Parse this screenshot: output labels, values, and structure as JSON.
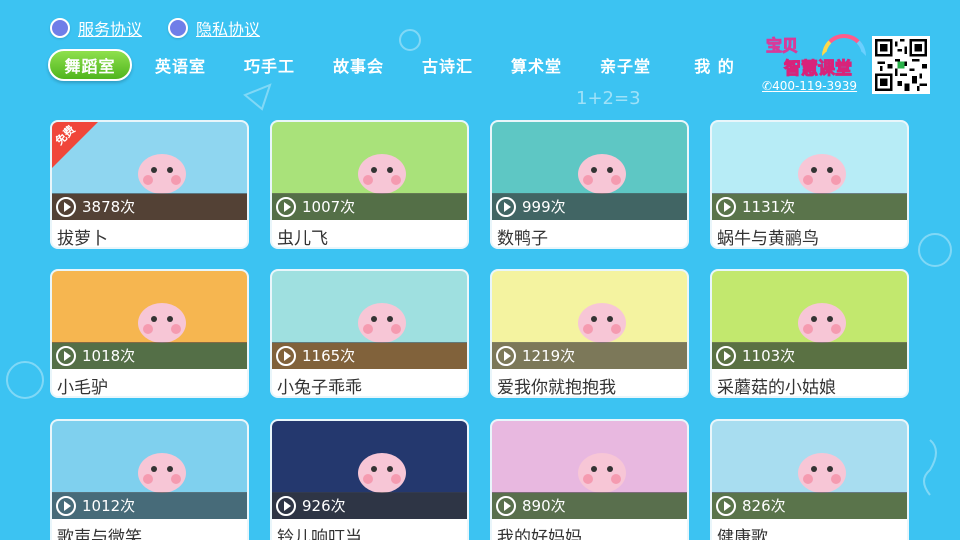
{
  "agreements": {
    "service": "服务协议",
    "privacy": "隐私协议"
  },
  "tabs": [
    "舞蹈室",
    "英语室",
    "巧手工",
    "故事会",
    "古诗汇",
    "算术堂",
    "亲子堂",
    "我 的"
  ],
  "active_tab": 0,
  "brand": {
    "logo_line1": "宝贝",
    "logo_line2": "智慧课堂",
    "phone": "400-119-3939"
  },
  "doodle_text": "1+2=3",
  "free_badge": "免费",
  "cards": [
    {
      "title": "拔萝卜",
      "plays": "3878次",
      "bg": "#8fd6f0",
      "ground": "#7a4a2a",
      "free": true
    },
    {
      "title": "虫儿飞",
      "plays": "1007次",
      "bg": "#a9e27a",
      "ground": "#7cc25a",
      "free": false
    },
    {
      "title": "数鸭子",
      "plays": "999次",
      "bg": "#5ec7c4",
      "ground": "#4aa8a6",
      "free": false
    },
    {
      "title": "蜗牛与黄鹂鸟",
      "plays": "1131次",
      "bg": "#b7ecf6",
      "ground": "#8cd064",
      "free": false
    },
    {
      "title": "小毛驴",
      "plays": "1018次",
      "bg": "#f6b650",
      "ground": "#7cc25a",
      "free": false
    },
    {
      "title": "小兔子乖乖",
      "plays": "1165次",
      "bg": "#9fe0e0",
      "ground": "#f2a13a",
      "free": false
    },
    {
      "title": "爱我你就抱抱我",
      "plays": "1219次",
      "bg": "#f4f3a0",
      "ground": "#e4d98a",
      "free": false
    },
    {
      "title": "采蘑菇的小姑娘",
      "plays": "1103次",
      "bg": "#c2e86e",
      "ground": "#8bc850",
      "free": false
    },
    {
      "title": "歌声与微笑",
      "plays": "1012次",
      "bg": "#7fd0ee",
      "ground": "#5ab8dc",
      "free": false
    },
    {
      "title": "铃儿响叮当",
      "plays": "926次",
      "bg": "#24386e",
      "ground": "#1a2a56",
      "free": false
    },
    {
      "title": "我的好妈妈",
      "plays": "890次",
      "bg": "#e8b8e0",
      "ground": "#8ac36a",
      "free": false
    },
    {
      "title": "健康歌",
      "plays": "826次",
      "bg": "#a8ddf0",
      "ground": "#8cd064",
      "free": false
    }
  ]
}
